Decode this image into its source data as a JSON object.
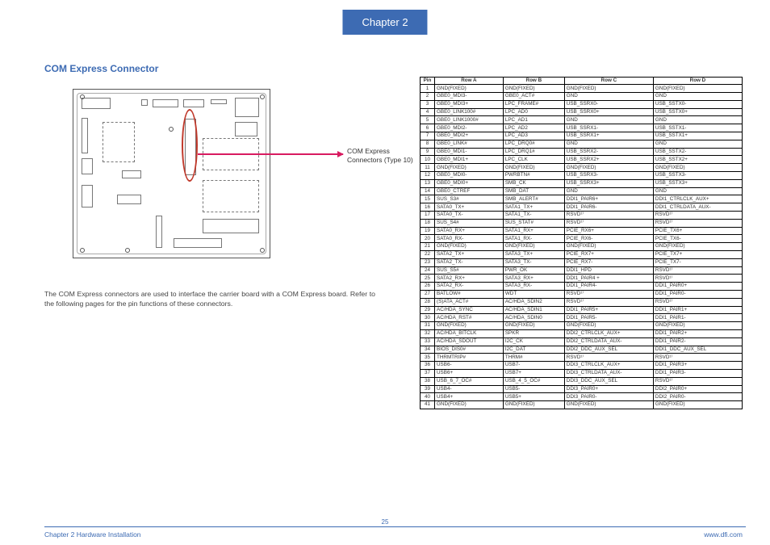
{
  "header": {
    "chapter_tab": "Chapter 2"
  },
  "section": {
    "title": "COM Express Connector"
  },
  "callout": {
    "line1": "COM Express",
    "line2": "Connectors (Type 10)"
  },
  "body": {
    "text": "The COM Express connectors are used to interface the carrier board with a COM Express board. Refer to the following pages for the pin functions of these connectors."
  },
  "table": {
    "headers": [
      "Pin",
      "Row A",
      "Row B",
      "Row C",
      "Row D"
    ],
    "rows": [
      [
        "1",
        "GND(FIXED)",
        "GND(FIXED)",
        "GND(FIXED)",
        "GND(FIXED)"
      ],
      [
        "2",
        "GBE0_MDI3-",
        "GBE0_ACT#",
        "GND",
        "GND"
      ],
      [
        "3",
        "GBE0_MDI3+",
        "LPC_FRAME#",
        "USB_SSRX0-",
        "USB_SSTX0-"
      ],
      [
        "4",
        "GBE0_LINK100#",
        "LPC_AD0",
        "USB_SSRX0+",
        "USB_SSTX0+"
      ],
      [
        "5",
        "GBE0_LINK1000#",
        "LPC_AD1",
        "GND",
        "GND"
      ],
      [
        "6",
        "GBE0_MDI2-",
        "LPC_AD2",
        "USB_SSRX1-",
        "USB_SSTX1-"
      ],
      [
        "7",
        "GBE0_MDI2+",
        "LPC_AD3",
        "USB_SSRX1+",
        "USB_SSTX1+"
      ],
      [
        "8",
        "GBE0_LINK#",
        "LPC_DRQ0#",
        "GND",
        "GND"
      ],
      [
        "9",
        "GBE0_MDI1-",
        "LPC_DRQ1#",
        "USB_SSRX2-",
        "USB_SSTX2-"
      ],
      [
        "10",
        "GBE0_MDI1+",
        "LPC_CLK",
        "USB_SSRX2+",
        "USB_SSTX2+"
      ],
      [
        "11",
        "GND(FIXED)",
        "GND(FIXED)",
        "GND(FIXED)",
        "GND(FIXED)"
      ],
      [
        "12",
        "GBE0_MDI0-",
        "PWRBTN#",
        "USB_SSRX3-",
        "USB_SSTX3-"
      ],
      [
        "13",
        "GBE0_MDI0+",
        "SMB_CK",
        "USB_SSRX3+",
        "USB_SSTX3+"
      ],
      [
        "14",
        "GBE0_CTREF",
        "SMB_DAT",
        "GND",
        "GND"
      ],
      [
        "15",
        "SUS_S3#",
        "SMB_ALERT#",
        "DDI1_PAIR6+",
        "DDI1_CTRLCLK_AUX+"
      ],
      [
        "16",
        "SATA0_TX+",
        "SATA1_TX+",
        "DDI1_PAIR6-",
        "DDI1_CTRLDATA_AUX-"
      ],
      [
        "17",
        "SATA0_TX-",
        "SATA1_TX-",
        "RSVD¹⁾",
        "RSVD¹⁾"
      ],
      [
        "18",
        "SUS_S4#",
        "SUS_STAT#",
        "RSVD¹⁾",
        "RSVD¹⁾"
      ],
      [
        "19",
        "SATA0_RX+",
        "SATA1_RX+",
        "PCIE_RX6+",
        "PCIE_TX6+"
      ],
      [
        "20",
        "SATA0_RX-",
        "SATA1_RX-",
        "PCIE_RX6-",
        "PCIE_TX6-"
      ],
      [
        "21",
        "GND(FIXED)",
        "GND(FIXED)",
        "GND(FIXED)",
        "GND(FIXED)"
      ],
      [
        "22",
        "SATA2_TX+",
        "SATA3_TX+",
        "PCIE_RX7+",
        "PCIE_TX7+"
      ],
      [
        "23",
        "SATA2_TX-",
        "SATA3_TX-",
        "PCIE_RX7-",
        "PCIE_TX7-"
      ],
      [
        "24",
        "SUS_S5#",
        "PWR_OK",
        "DDI1_HPD",
        "RSVD¹⁾"
      ],
      [
        "25",
        "SATA2_RX+",
        "SATA3_RX+",
        "DDI1_PAIR4 +",
        "RSVD¹⁾"
      ],
      [
        "26",
        "SATA2_RX-",
        "SATA3_RX-",
        "DDI1_PAIR4-",
        "DDI1_PAIR0+"
      ],
      [
        "27",
        "BATLOW#",
        "WDT",
        "RSVD¹⁾",
        "DDI1_PAIR0-"
      ],
      [
        "28",
        "(S)ATA_ACT#",
        "AC/HDA_SDIN2",
        "RSVD¹⁾",
        "RSVD¹⁾"
      ],
      [
        "29",
        "AC/HDA_SYNC",
        "AC/HDA_SDIN1",
        "DDI1_PAIR5+",
        "DDI1_PAIR1+"
      ],
      [
        "30",
        "AC/HDA_RST#",
        "AC/HDA_SDIN0",
        "DDI1_PAIR5-",
        "DDI1_PAIR1-"
      ],
      [
        "31",
        "GND(FIXED)",
        "GND(FIXED)",
        "GND(FIXED)",
        "GND(FIXED)"
      ],
      [
        "32",
        "AC/HDA_BITCLK",
        "SPKR",
        "DDI2_CTRLCLK_AUX+",
        "DDI1_PAIR2+"
      ],
      [
        "33",
        "AC/HDA_SDOUT",
        "I2C_CK",
        "DDI2_CTRLDATA_AUX-",
        "DDI1_PAIR2-"
      ],
      [
        "34",
        "BIOS_DIS0#",
        "I2C_DAT",
        "DDI2_DDC_AUX_SEL",
        "DDI1_DDC_AUX_SEL"
      ],
      [
        "35",
        "THRMTRIP#",
        "THRM#",
        "RSVD¹⁾",
        "RSVD¹⁾"
      ],
      [
        "36",
        "USB6-",
        "USB7-",
        "DDI3_CTRLCLK_AUX+",
        "DDI1_PAIR3+"
      ],
      [
        "37",
        "USB6+",
        "USB7+",
        "DDI3_CTRLDATA_AUX-",
        "DDI1_PAIR3-"
      ],
      [
        "38",
        "USB_6_7_OC#",
        "USB_4_5_OC#",
        "DDI3_DDC_AUX_SEL",
        "RSVD¹⁾"
      ],
      [
        "39",
        "USB4-",
        "USB5-",
        "DDI3_PAIR0+",
        "DDI2_PAIR0+"
      ],
      [
        "40",
        "USB4+",
        "USB5+",
        "DDI3_PAIR0-",
        "DDI2_PAIR0-"
      ],
      [
        "41",
        "GND(FIXED)",
        "GND(FIXED)",
        "GND(FIXED)",
        "GND(FIXED)"
      ]
    ]
  },
  "footer": {
    "page_number": "25",
    "left": "Chapter 2 Hardware Installation",
    "right": "www.dfi.com"
  }
}
